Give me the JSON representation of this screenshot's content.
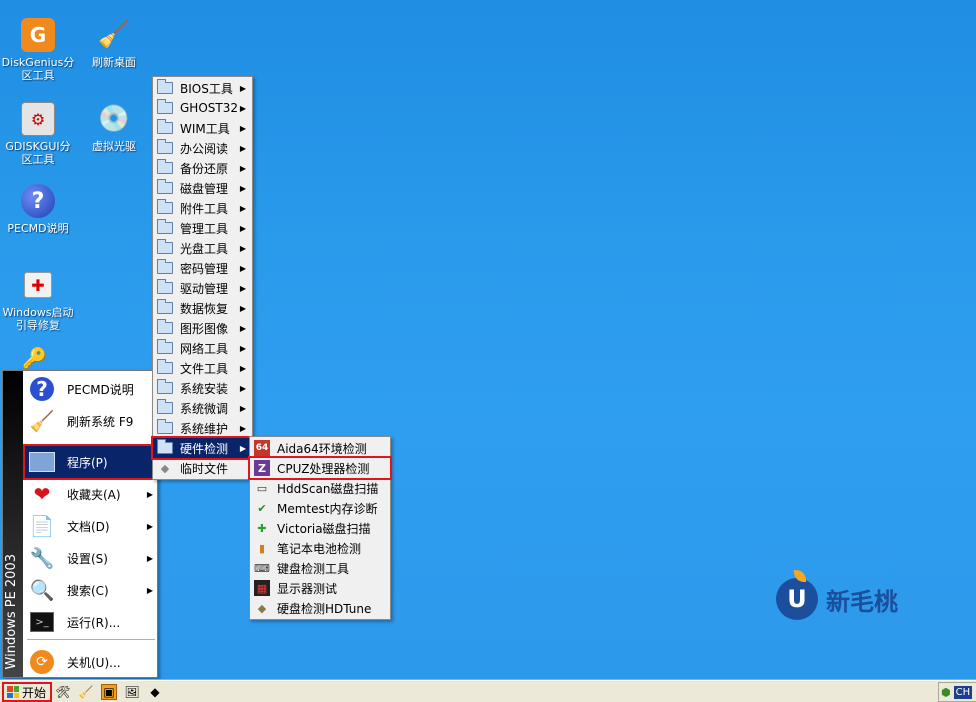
{
  "desktop": {
    "icons": [
      {
        "label": "DiskGenius分区工具",
        "icon": "diskgenius-icon"
      },
      {
        "label": "刷新桌面",
        "icon": "refresh-desktop-icon"
      },
      {
        "label": "GDISKGUI分区工具",
        "icon": "gdisk-icon"
      },
      {
        "label": "虚拟光驱",
        "icon": "virtual-cd-icon"
      },
      {
        "label": "PECMD说明",
        "icon": "help-icon"
      },
      {
        "label": "Windows启动引导修复",
        "icon": "repair-kit-icon"
      }
    ],
    "logo_text": "新毛桃",
    "logo_letter": "U"
  },
  "start_menu": {
    "band_text": "Windows PE 2003",
    "items": [
      {
        "label": "PECMD说明",
        "icon": "help-icon"
      },
      {
        "label": "刷新系统 F9",
        "icon": "refresh-system-icon"
      },
      {
        "label": "程序(P)",
        "icon": "programs-folder-icon",
        "active": true
      },
      {
        "label": "收藏夹(A)",
        "icon": "favorites-heart-icon"
      },
      {
        "label": "文档(D)",
        "icon": "documents-icon"
      },
      {
        "label": "设置(S)",
        "icon": "settings-tools-icon"
      },
      {
        "label": "搜索(C)",
        "icon": "search-icon"
      },
      {
        "label": "运行(R)...",
        "icon": "run-console-icon"
      },
      {
        "label": "关机(U)...",
        "icon": "shutdown-icon"
      }
    ]
  },
  "programs_menu": {
    "items": [
      "BIOS工具",
      "GHOST32",
      "WIM工具",
      "办公阅读",
      "备份还原",
      "磁盘管理",
      "附件工具",
      "管理工具",
      "光盘工具",
      "密码管理",
      "驱动管理",
      "数据恢复",
      "图形图像",
      "网络工具",
      "文件工具",
      "系统安装",
      "系统微调",
      "系统维护",
      "硬件检测",
      "临时文件"
    ],
    "selected": "硬件检测"
  },
  "hardware_menu": {
    "items": [
      {
        "label": "Aida64环境检测",
        "icon": "aida64-icon"
      },
      {
        "label": "CPUZ处理器检测",
        "icon": "cpuz-icon"
      },
      {
        "label": "HddScan磁盘扫描",
        "icon": "hddscan-icon"
      },
      {
        "label": "Memtest内存诊断",
        "icon": "memtest-icon"
      },
      {
        "label": "Victoria磁盘扫描",
        "icon": "victoria-icon"
      },
      {
        "label": "笔记本电池检测",
        "icon": "battery-icon"
      },
      {
        "label": "键盘检测工具",
        "icon": "keyboard-icon"
      },
      {
        "label": "显示器测试",
        "icon": "monitor-icon"
      },
      {
        "label": "硬盘检测HDTune",
        "icon": "hdtune-icon"
      }
    ],
    "highlighted": "CPUZ处理器检测"
  },
  "taskbar": {
    "start_label": "开始",
    "tray_lang": "CH"
  }
}
